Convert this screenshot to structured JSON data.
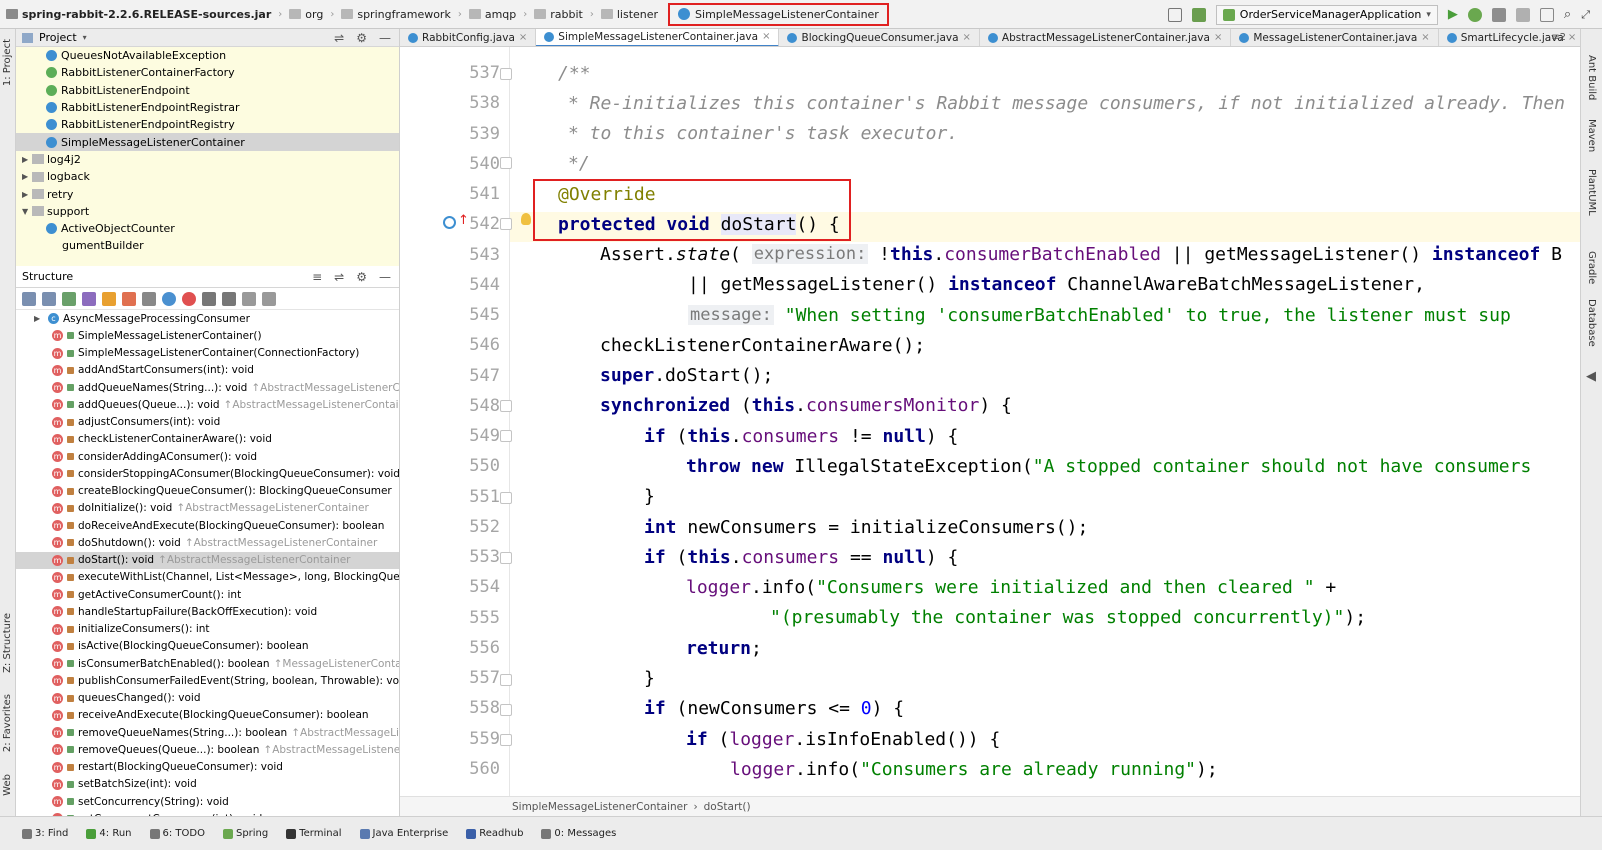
{
  "nav": {
    "crumbs": [
      "spring-rabbit-2.2.6.RELEASE-sources.jar",
      "org",
      "springframework",
      "amqp",
      "rabbit",
      "listener"
    ],
    "selected": "SimpleMessageListenerContainer",
    "run_config": "OrderServiceManagerApplication"
  },
  "left_strip": {
    "project": "1: Project",
    "structure": "Z: Structure",
    "favorites": "2: Favorites",
    "web": "Web"
  },
  "right_strip": {
    "ant": "Ant Build",
    "maven": "Maven",
    "plantuml": "PlantUML",
    "gradle": "Gradle",
    "database": "Database"
  },
  "project": {
    "title": "Project",
    "items": [
      {
        "label": "QueuesNotAvailableException",
        "type": "class"
      },
      {
        "label": "RabbitListenerContainerFactory",
        "type": "interface"
      },
      {
        "label": "RabbitListenerEndpoint",
        "type": "interface"
      },
      {
        "label": "RabbitListenerEndpointRegistrar",
        "type": "class"
      },
      {
        "label": "RabbitListenerEndpointRegistry",
        "type": "class"
      },
      {
        "label": "SimpleMessageListenerContainer",
        "type": "class",
        "selected": true
      },
      {
        "label": "log4j2",
        "type": "folder"
      },
      {
        "label": "logback",
        "type": "folder"
      },
      {
        "label": "retry",
        "type": "folder"
      },
      {
        "label": "support",
        "type": "folder-open"
      },
      {
        "label": "ActiveObjectCounter",
        "type": "class"
      },
      {
        "label": "gumentBuilder",
        "type": "partial"
      }
    ]
  },
  "structure": {
    "title": "Structure",
    "items": [
      {
        "label": "AsyncMessageProcessingConsumer",
        "inh": "",
        "kind": "class"
      },
      {
        "label": "SimpleMessageListenerContainer()",
        "inh": "",
        "kind": "public"
      },
      {
        "label": "SimpleMessageListenerContainer(ConnectionFactory)",
        "inh": "",
        "kind": "public"
      },
      {
        "label": "addAndStartConsumers(int): void",
        "inh": "",
        "kind": "protected"
      },
      {
        "label": "addQueueNames(String...): void",
        "inh": "↑AbstractMessageListenerContain",
        "kind": "public"
      },
      {
        "label": "addQueues(Queue...): void",
        "inh": "↑AbstractMessageListenerContainer",
        "kind": "public"
      },
      {
        "label": "adjustConsumers(int): void",
        "inh": "",
        "kind": "protected"
      },
      {
        "label": "checkListenerContainerAware(): void",
        "inh": "",
        "kind": "private"
      },
      {
        "label": "considerAddingAConsumer(): void",
        "inh": "",
        "kind": "private"
      },
      {
        "label": "considerStoppingAConsumer(BlockingQueueConsumer): void",
        "inh": "",
        "kind": "private"
      },
      {
        "label": "createBlockingQueueConsumer(): BlockingQueueConsumer",
        "inh": "",
        "kind": "protected"
      },
      {
        "label": "doInitialize(): void",
        "inh": "↑AbstractMessageListenerContainer",
        "kind": "protected"
      },
      {
        "label": "doReceiveAndExecute(BlockingQueueConsumer): boolean",
        "inh": "",
        "kind": "private"
      },
      {
        "label": "doShutdown(): void",
        "inh": "↑AbstractMessageListenerContainer",
        "kind": "protected"
      },
      {
        "label": "doStart(): void",
        "inh": "↑AbstractMessageListenerContainer",
        "kind": "protected",
        "selected": true
      },
      {
        "label": "executeWithList(Channel, List<Message>, long, BlockingQueueCor",
        "inh": "",
        "kind": "private"
      },
      {
        "label": "getActiveConsumerCount(): int",
        "inh": "",
        "kind": "protected"
      },
      {
        "label": "handleStartupFailure(BackOffExecution): void",
        "inh": "",
        "kind": "protected"
      },
      {
        "label": "initializeConsumers(): int",
        "inh": "",
        "kind": "protected"
      },
      {
        "label": "isActive(BlockingQueueConsumer): boolean",
        "inh": "",
        "kind": "protected"
      },
      {
        "label": "isConsumerBatchEnabled(): boolean",
        "inh": "↑MessageListenerContainer",
        "kind": "public"
      },
      {
        "label": "publishConsumerFailedEvent(String, boolean, Throwable): void",
        "inh": "↑Al",
        "kind": "protected"
      },
      {
        "label": "queuesChanged(): void",
        "inh": "",
        "kind": "private"
      },
      {
        "label": "receiveAndExecute(BlockingQueueConsumer): boolean",
        "inh": "",
        "kind": "private"
      },
      {
        "label": "removeQueueNames(String...): boolean",
        "inh": "↑AbstractMessageListener",
        "kind": "public"
      },
      {
        "label": "removeQueues(Queue...): boolean",
        "inh": "↑AbstractMessageListenerCont",
        "kind": "public"
      },
      {
        "label": "restart(BlockingQueueConsumer): void",
        "inh": "",
        "kind": "private"
      },
      {
        "label": "setBatchSize(int): void",
        "inh": "",
        "kind": "public"
      },
      {
        "label": "setConcurrency(String): void",
        "inh": "",
        "kind": "public"
      },
      {
        "label": "setConcurrentConsumers(int): void",
        "inh": "",
        "kind": "public"
      }
    ]
  },
  "tabs": [
    {
      "label": "RabbitConfig.java",
      "active": false
    },
    {
      "label": "SimpleMessageListenerContainer.java",
      "active": true
    },
    {
      "label": "BlockingQueueConsumer.java",
      "active": false
    },
    {
      "label": "AbstractMessageListenerContainer.java",
      "active": false
    },
    {
      "label": "MessageListenerContainer.java",
      "active": false
    },
    {
      "label": "SmartLifecycle.java",
      "active": false
    }
  ],
  "tabs_overflow": "≡2",
  "editor": {
    "lines": [
      "537",
      "538",
      "539",
      "540",
      "541",
      "542",
      "543",
      "544",
      "545",
      "546",
      "547",
      "548",
      "549",
      "550",
      "551",
      "552",
      "553",
      "554",
      "555",
      "556",
      "557",
      "558",
      "559",
      "560"
    ],
    "code": {
      "l537": "/**",
      "l538": "* Re-initializes this container's Rabbit message consumers, if not initialized already. Then",
      "l539": "* to this container's task executor.",
      "l540": "*/",
      "l541": "@Override",
      "l542_kw": "protected void ",
      "l542_name": "doStart",
      "l542_rest": "() {",
      "l543_a": "Assert.",
      "l543_b": "state",
      "l543_c": "( ",
      "l543_hint": "expression:",
      "l543_d": " !",
      "l543_e": "this",
      "l543_f": ".",
      "l543_g": "consumerBatchEnabled",
      "l543_h": " || getMessageListener() ",
      "l543_i": "instanceof",
      "l543_j": " B",
      "l544_a": "|| getMessageListener() ",
      "l544_b": "instanceof",
      "l544_c": " ChannelAwareBatchMessageListener,",
      "l545_hint": "message:",
      "l545_str": " \"When setting 'consumerBatchEnabled' to true, the listener must sup",
      "l546": "checkListenerContainerAware();",
      "l547_a": "super",
      "l547_b": ".doStart();",
      "l548_a": "synchronized",
      "l548_b": " (",
      "l548_c": "this",
      "l548_d": ".",
      "l548_e": "consumersMonitor",
      "l548_f": ") {",
      "l549_a": "if",
      "l549_b": " (",
      "l549_c": "this",
      "l549_d": ".",
      "l549_e": "consumers",
      "l549_f": " != ",
      "l549_g": "null",
      "l549_h": ") {",
      "l550_a": "throw new",
      "l550_b": " IllegalStateException(",
      "l550_c": "\"A stopped container should not have consumers",
      "l551": "}",
      "l552_a": "int",
      "l552_b": " newConsumers = initializeConsumers();",
      "l553_a": "if",
      "l553_b": " (",
      "l553_c": "this",
      "l553_d": ".",
      "l553_e": "consumers",
      "l553_f": " == ",
      "l553_g": "null",
      "l553_h": ") {",
      "l554_a": "logger",
      "l554_b": ".info(",
      "l554_c": "\"Consumers were initialized and then cleared \"",
      "l554_d": " +",
      "l555_a": "\"(presumably the container was stopped concurrently)\"",
      "l555_b": ");",
      "l556_a": "return",
      "l556_b": ";",
      "l557": "}",
      "l558_a": "if",
      "l558_b": " (newConsumers <= ",
      "l558_c": "0",
      "l558_d": ") {",
      "l559_a": "if",
      "l559_b": " (",
      "l559_c": "logger",
      "l559_d": ".isInfoEnabled()) {",
      "l560_a": "logger",
      "l560_b": ".info(",
      "l560_c": "\"Consumers are already running\"",
      "l560_d": ");"
    }
  },
  "breadcrumb": {
    "class": "SimpleMessageListenerContainer",
    "sep": "›",
    "method": "doStart()"
  },
  "status": [
    "3: Find",
    "4: Run",
    "6: TODO",
    "Spring",
    "Terminal",
    "Java Enterprise",
    "Readhub",
    "0: Messages"
  ]
}
